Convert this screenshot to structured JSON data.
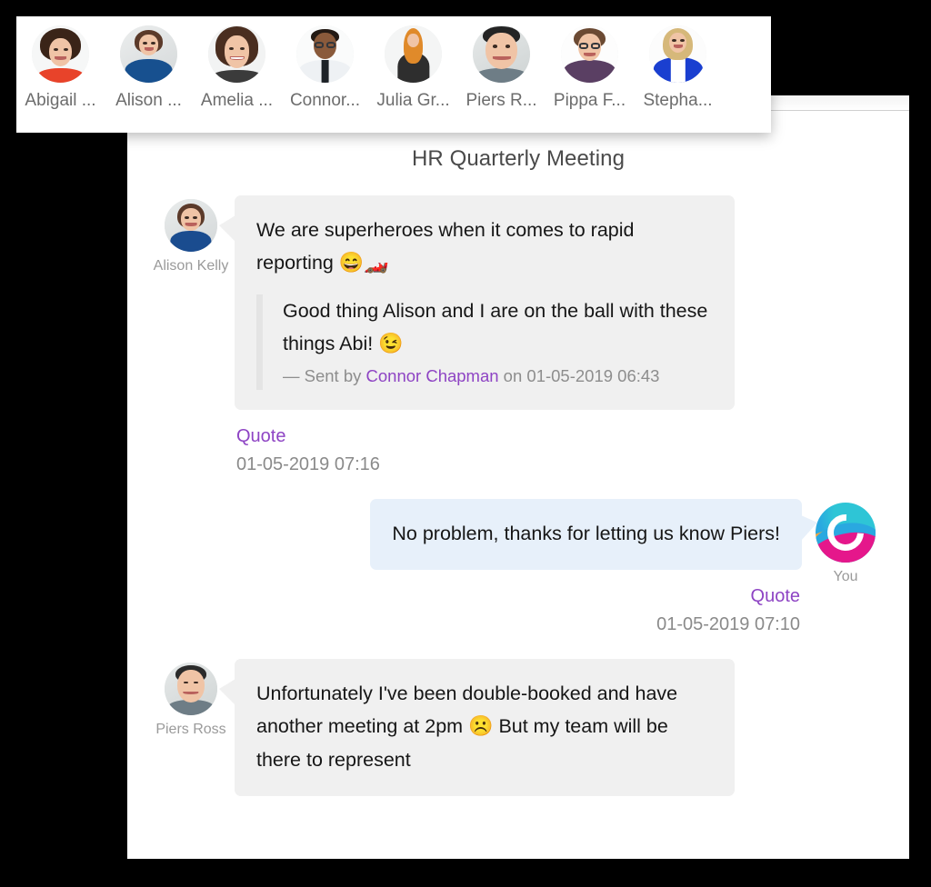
{
  "avatar_bar": {
    "people": [
      {
        "name": "Abigail ...",
        "full": "Abigail"
      },
      {
        "name": "Alison ...",
        "full": "Alison"
      },
      {
        "name": "Amelia ...",
        "full": "Amelia"
      },
      {
        "name": "Connor...",
        "full": "Connor"
      },
      {
        "name": "Julia Gr...",
        "full": "Julia Gr"
      },
      {
        "name": "Piers R...",
        "full": "Piers R"
      },
      {
        "name": "Pippa F...",
        "full": "Pippa F"
      },
      {
        "name": "Stepha...",
        "full": "Stepha"
      }
    ]
  },
  "chat": {
    "title": "HR Quarterly Meeting",
    "messages": [
      {
        "sender": "Alison Kelly",
        "direction": "incoming",
        "text": "We are superheroes when it comes to rapid reporting ",
        "emoji": "😄🏎️",
        "quote": {
          "text": "Good thing Alison and I are on the ball with these things Abi! ",
          "emoji": "😉",
          "prefix": "— Sent by ",
          "author": "Connor Chapman",
          "suffix": " on 01-05-2019 06:43"
        },
        "quote_label": "Quote",
        "timestamp": "01-05-2019 07:16"
      },
      {
        "sender": "You",
        "direction": "outgoing",
        "text": "No problem, thanks for letting us know Piers!",
        "quote_label": "Quote",
        "timestamp": "01-05-2019 07:10"
      },
      {
        "sender": "Piers Ross",
        "direction": "incoming",
        "text_a": "Unfortunately I've been double-booked and have another meeting at 2pm ",
        "emoji": "☹️",
        "text_b": " But my team will be there to represent"
      }
    ]
  },
  "colors": {
    "accent_purple": "#8e44c4",
    "incoming_bubble": "#f0f0f0",
    "outgoing_bubble": "#e7f0fa",
    "muted_text": "#8a8a8a",
    "title_text": "#4a4a4a"
  }
}
